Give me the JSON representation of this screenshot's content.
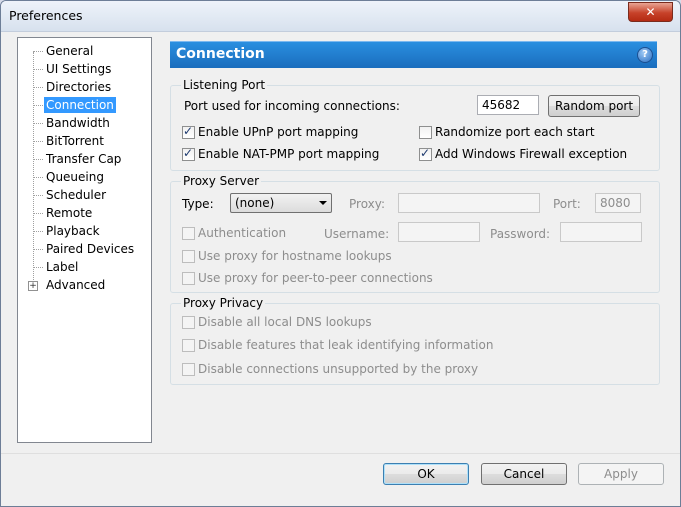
{
  "window": {
    "title": "Preferences",
    "close_glyph": "✕"
  },
  "sidebar": {
    "items": [
      {
        "label": "General"
      },
      {
        "label": "UI Settings"
      },
      {
        "label": "Directories"
      },
      {
        "label": "Connection",
        "selected": true
      },
      {
        "label": "Bandwidth"
      },
      {
        "label": "BitTorrent"
      },
      {
        "label": "Transfer Cap"
      },
      {
        "label": "Queueing"
      },
      {
        "label": "Scheduler"
      },
      {
        "label": "Remote"
      },
      {
        "label": "Playback"
      },
      {
        "label": "Paired Devices"
      },
      {
        "label": "Label"
      },
      {
        "label": "Advanced",
        "expandable": true,
        "expander": "+"
      }
    ]
  },
  "header": {
    "title": "Connection",
    "help": "?"
  },
  "listening_port": {
    "group_label": "Listening Port",
    "port_label": "Port used for incoming connections:",
    "port_value": "45682",
    "random_port_button": "Random port",
    "upnp": {
      "label": "Enable UPnP port mapping",
      "checked": true
    },
    "randomize": {
      "label": "Randomize port each start",
      "checked": false
    },
    "natpmp": {
      "label": "Enable NAT-PMP port mapping",
      "checked": true
    },
    "firewall": {
      "label": "Add Windows Firewall exception",
      "checked": true
    }
  },
  "proxy_server": {
    "group_label": "Proxy Server",
    "type_label": "Type:",
    "type_value": "(none)",
    "proxy_label": "Proxy:",
    "proxy_value": "",
    "port_label": "Port:",
    "port_value": "8080",
    "authentication": {
      "label": "Authentication",
      "checked": false
    },
    "username_label": "Username:",
    "username_value": "",
    "password_label": "Password:",
    "password_value": "",
    "hostname_lookups": {
      "label": "Use proxy for hostname lookups",
      "checked": false
    },
    "p2p": {
      "label": "Use proxy for peer-to-peer connections",
      "checked": false
    }
  },
  "proxy_privacy": {
    "group_label": "Proxy Privacy",
    "dns": {
      "label": "Disable all local DNS lookups",
      "checked": false
    },
    "leak": {
      "label": "Disable features that leak identifying information",
      "checked": false
    },
    "unsupported": {
      "label": "Disable connections unsupported by the proxy",
      "checked": false
    }
  },
  "footer": {
    "ok": "OK",
    "cancel": "Cancel",
    "apply": "Apply"
  },
  "colors": {
    "header": "#1a6dbd",
    "selection": "#3399ff",
    "close": "#c7422a"
  }
}
